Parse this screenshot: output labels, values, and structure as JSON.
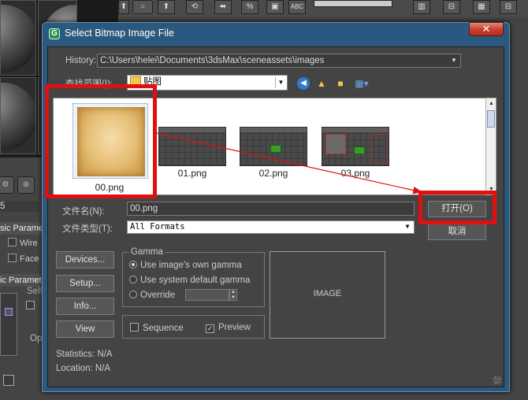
{
  "dialog": {
    "title": "Select Bitmap Image File",
    "app_icon": "G",
    "close_label": "✕"
  },
  "history": {
    "label": "History:",
    "value": "C:\\Users\\helei\\Documents\\3dsMax\\sceneassets\\images"
  },
  "lookin": {
    "label": "查找范围(I):",
    "value": "贴图"
  },
  "nav_icons": [
    "back-icon",
    "up-folder-icon",
    "new-folder-icon",
    "view-menu-icon"
  ],
  "thumbnails": [
    {
      "name": "00.png",
      "kind": "parchment"
    },
    {
      "name": "01.png",
      "kind": "viewport"
    },
    {
      "name": "02.png",
      "kind": "viewport-cube"
    },
    {
      "name": "03.png",
      "kind": "viewport-ui"
    }
  ],
  "filename": {
    "label": "文件名(N):",
    "value": "00.png"
  },
  "filetype": {
    "label": "文件类型(T):",
    "value": "All Formats"
  },
  "buttons": {
    "open": "打开(O)",
    "cancel": "取消"
  },
  "side_buttons": [
    "Devices...",
    "Setup...",
    "Info...",
    "View"
  ],
  "gamma": {
    "title": "Gamma",
    "options": [
      "Use image's own gamma",
      "Use system default gamma",
      "Override"
    ],
    "selected": 0,
    "override_value": ""
  },
  "checks": {
    "sequence": "Sequence",
    "preview": "Preview",
    "sequence_checked": false,
    "preview_checked": true
  },
  "preview_label": "IMAGE",
  "statistics": {
    "label": "Statistics:",
    "value": "N/A"
  },
  "location": {
    "label": "Location:",
    "value": "N/A"
  },
  "background": {
    "toolbar_icons": [
      "⬆",
      "⟲",
      "%",
      "⬌",
      "%",
      "▣",
      "ABC",
      "▥",
      "⊟",
      "▦"
    ],
    "rollout_1": "sic Paramete",
    "rollout_1_items": [
      "Wire",
      "Face"
    ],
    "rollout_2": "ic Paramete",
    "rollout_2_sub": "Self",
    "rollout_2_btn": "Op",
    "left_value": "5"
  },
  "colors": {
    "dialog_frame": "#2b587e",
    "annotation": "#e01010",
    "close_button": "#c9442f"
  }
}
